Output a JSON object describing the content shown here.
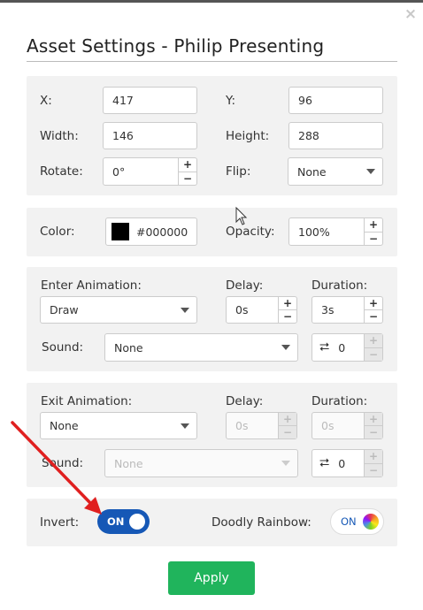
{
  "dialog": {
    "title": "Asset Settings - Philip Presenting",
    "close_icon": "×"
  },
  "transform": {
    "x_label": "X:",
    "x_value": "417",
    "y_label": "Y:",
    "y_value": "96",
    "width_label": "Width:",
    "width_value": "146",
    "height_label": "Height:",
    "height_value": "288",
    "rotate_label": "Rotate:",
    "rotate_value": "0°",
    "flip_label": "Flip:",
    "flip_value": "None"
  },
  "appearance": {
    "color_label": "Color:",
    "color_value": "#000000",
    "opacity_label": "Opacity:",
    "opacity_value": "100%"
  },
  "enter_animation": {
    "label": "Enter Animation:",
    "value": "Draw",
    "delay_label": "Delay:",
    "delay_value": "0s",
    "duration_label": "Duration:",
    "duration_value": "3s",
    "sound_label": "Sound:",
    "sound_value": "None",
    "loop_count": "0"
  },
  "exit_animation": {
    "label": "Exit Animation:",
    "value": "None",
    "delay_label": "Delay:",
    "delay_value": "0s",
    "duration_label": "Duration:",
    "duration_value": "0s",
    "sound_label": "Sound:",
    "sound_placeholder": "None",
    "loop_count": "0"
  },
  "toggles": {
    "invert_label": "Invert:",
    "invert_state": "ON",
    "rainbow_label": "Doodly Rainbow:",
    "rainbow_state": "ON"
  },
  "footer": {
    "apply_label": "Apply"
  },
  "colors": {
    "accent_blue": "#1658b6",
    "apply_green": "#20b45c",
    "annotation_red": "#e02020"
  },
  "icons": {
    "spin_up": "+",
    "spin_down": "−",
    "loop": "⮂"
  }
}
